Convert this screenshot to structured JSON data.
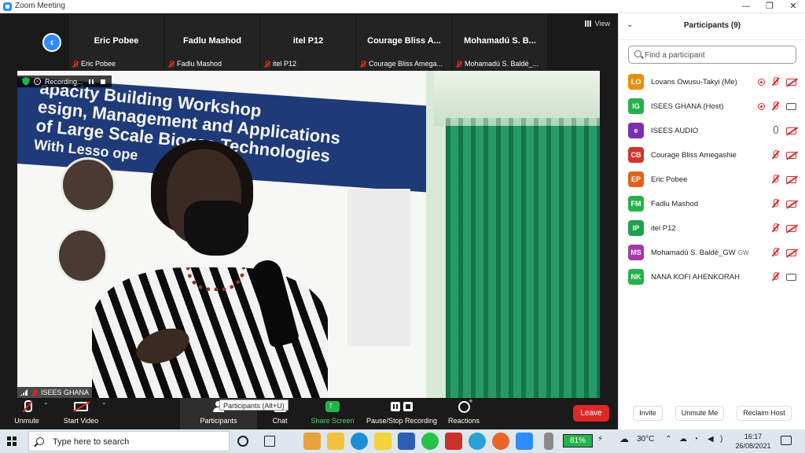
{
  "window": {
    "title": "Zoom Meeting"
  },
  "meeting": {
    "view_label": "View",
    "thumbnails": [
      {
        "name": "Eric Pobee",
        "footer": "Eric Pobee"
      },
      {
        "name": "Fadlu Mashod",
        "footer": "Fadlu Mashod"
      },
      {
        "name": "itel P12",
        "footer": "itel P12"
      },
      {
        "name": "Courage Bliss A...",
        "footer": "Courage Bliss Amega..."
      },
      {
        "name": "Mohamadú S. B...",
        "footer": "Mohamadú S. Baldé_..."
      }
    ],
    "recording_label": "Recording...",
    "active_speaker": "ISEES GHANA",
    "banner_lines": [
      "apacity Building Workshop",
      "esign, Management and Applications",
      "of Large Scale Biogas Technologies",
      "With Lesso              ope"
    ]
  },
  "toolbar": {
    "unmute": "Unmute",
    "start_video": "Start Video",
    "participants": "Participants",
    "chat": "Chat",
    "share_screen": "Share Screen",
    "pause_stop_recording": "Pause/Stop Recording",
    "reactions": "Reactions",
    "leave": "Leave",
    "tooltip": "Participants (Alt+U)"
  },
  "participants_panel": {
    "title": "Participants (9)",
    "search_placeholder": "Find a participant",
    "items": [
      {
        "initials": "LO",
        "name": "Lovans Owusu-Takyi (Me)",
        "tag": "",
        "color": "#e8900c",
        "recording": true,
        "mic": "off",
        "cam": "off"
      },
      {
        "initials": "IG",
        "name": "ISEES GHANA (Host)",
        "tag": "",
        "color": "#24b24a",
        "recording": true,
        "mic": "off",
        "cam": "on"
      },
      {
        "initials": "e",
        "name": "ISEES AUDIO",
        "tag": "",
        "color": "#7b2fb0",
        "recording": false,
        "mic": "on",
        "cam": "off"
      },
      {
        "initials": "CB",
        "name": "Courage Bliss Amegashie",
        "tag": "",
        "color": "#d0342c",
        "recording": false,
        "mic": "off",
        "cam": "off"
      },
      {
        "initials": "EP",
        "name": "Eric Pobee",
        "tag": "",
        "color": "#e06418",
        "recording": false,
        "mic": "off",
        "cam": "off"
      },
      {
        "initials": "FM",
        "name": "Fadlu Mashod",
        "tag": "",
        "color": "#24b24a",
        "recording": false,
        "mic": "off",
        "cam": "off"
      },
      {
        "initials": "IP",
        "name": "itel P12",
        "tag": "",
        "color": "#1fa04c",
        "recording": false,
        "mic": "off",
        "cam": "off"
      },
      {
        "initials": "MS",
        "name": "Mohamadú S. Baldé_GW",
        "tag": "GW",
        "color": "#a23aa8",
        "recording": false,
        "mic": "off",
        "cam": "off"
      },
      {
        "initials": "NK",
        "name": "NANA KOFI AHENKORAH",
        "tag": "",
        "color": "#24b24a",
        "recording": false,
        "mic": "off",
        "cam": "on"
      }
    ],
    "invite": "Invite",
    "unmute_me": "Unmute Me",
    "reclaim_host": "Reclaim Host"
  },
  "taskbar": {
    "search_placeholder": "Type here to search",
    "battery": "81%",
    "temperature": "30°C",
    "time": "16:17",
    "date": "26/08/2021"
  }
}
